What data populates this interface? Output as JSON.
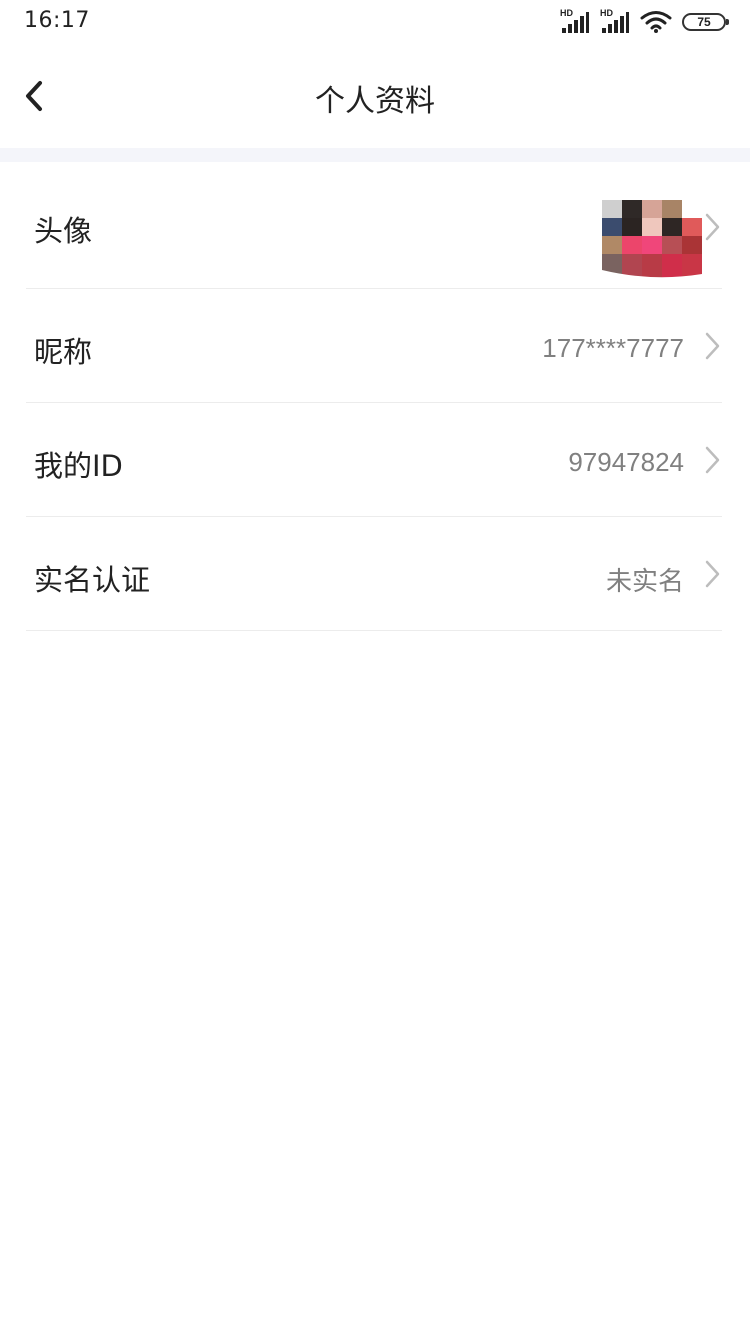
{
  "status_bar": {
    "time": "16:17",
    "signal_1_label": "HD",
    "signal_2_label": "HD",
    "wifi_icon": "wifi-icon",
    "battery": "75"
  },
  "navbar": {
    "back_icon": "chevron-left-icon",
    "title": "个人资料"
  },
  "profile": {
    "rows": [
      {
        "label": "头像",
        "type": "avatar",
        "icon": "chevron-right-icon"
      },
      {
        "label": "昵称",
        "value": "177****7777",
        "icon": "chevron-right-icon"
      },
      {
        "label": "我的ID",
        "value": "97947824",
        "icon": "chevron-right-icon"
      },
      {
        "label": "实名认证",
        "value": "未实名",
        "icon": "chevron-right-icon"
      }
    ]
  },
  "colors": {
    "text_primary": "#222222",
    "text_secondary": "#808080",
    "divider": "#ececec",
    "section_band": "#f4f5fa"
  }
}
